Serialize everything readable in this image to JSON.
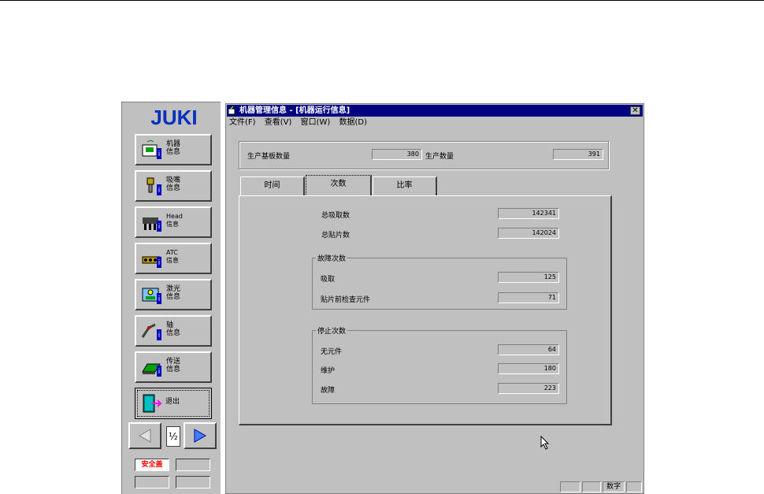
{
  "brand": {
    "logo_text": "JUKI"
  },
  "nav": {
    "items": [
      {
        "label": "机器\n信息",
        "icon": "machine-info-icon"
      },
      {
        "label": "吸嘴\n信息",
        "icon": "nozzle-info-icon"
      },
      {
        "label": "Head\n信息",
        "icon": "head-info-icon"
      },
      {
        "label": "ATC\n信息",
        "icon": "atc-info-icon"
      },
      {
        "label": "激光\n信息",
        "icon": "laser-info-icon"
      },
      {
        "label": "轴\n信息",
        "icon": "axis-info-icon"
      },
      {
        "label": "传送\n信息",
        "icon": "conveyor-info-icon"
      },
      {
        "label": "退出",
        "icon": "exit-icon"
      }
    ],
    "page_indicator": "½",
    "safety_label": "安全盖"
  },
  "window": {
    "title": "机器管理信息 - [机器运行信息]",
    "close": "✕",
    "menu": [
      "文件(F)",
      "查看(V)",
      "窗口(W)",
      "数据(D)"
    ]
  },
  "summary": {
    "boards_label": "生产基板数量",
    "boards_value": "380",
    "production_label": "生产数量",
    "production_value": "391"
  },
  "tabs": [
    {
      "label": "时间",
      "active": false
    },
    {
      "label": "次数",
      "active": true
    },
    {
      "label": "比率",
      "active": false
    }
  ],
  "counts": {
    "total_pickup_label": "总吸取数",
    "total_pickup_value": "142341",
    "total_mount_label": "总贴片数",
    "total_mount_value": "142024",
    "error_group_title": "故障次数",
    "pickup_err_label": "吸取",
    "pickup_err_value": "125",
    "precheck_label": "贴片前检查元件",
    "precheck_value": "71",
    "stop_group_title": "停止次数",
    "no_part_label": "无元件",
    "no_part_value": "64",
    "maint_label": "维护",
    "maint_value": "180",
    "fault_label": "故障",
    "fault_value": "223"
  },
  "statusbar": {
    "mode": "数字"
  }
}
